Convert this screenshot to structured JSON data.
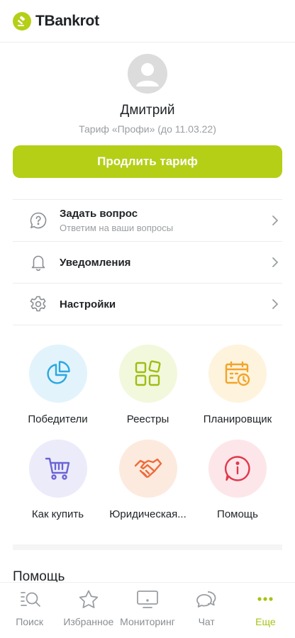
{
  "header": {
    "logo_text": "TBankrot"
  },
  "profile": {
    "name": "Дмитрий",
    "tariff": "Тариф «Профи» (до 11.03.22)"
  },
  "extend_button": {
    "label": "Продлить тариф"
  },
  "menu": {
    "items": [
      {
        "title": "Задать вопрос",
        "subtitle": "Ответим на ваши вопросы",
        "icon": "question-bubble-icon"
      },
      {
        "title": "Уведомления",
        "icon": "bell-icon"
      },
      {
        "title": "Настройки",
        "icon": "gear-icon"
      }
    ]
  },
  "tiles": [
    {
      "label": "Победители",
      "icon": "pie-chart-icon",
      "bg": "#e2f3fb",
      "color": "#2aa8e0"
    },
    {
      "label": "Реестры",
      "icon": "grid-icon",
      "bg": "#f2f8dc",
      "color": "#9fbc12"
    },
    {
      "label": "Планировщик",
      "icon": "calendar-clock-icon",
      "bg": "#fef3dc",
      "color": "#f2a42a"
    },
    {
      "label": "Как купить",
      "icon": "cart-icon",
      "bg": "#ecebfa",
      "color": "#6a64d6"
    },
    {
      "label": "Юридическая...",
      "icon": "handshake-icon",
      "bg": "#fdeade",
      "color": "#ef6a3a"
    },
    {
      "label": "Помощь",
      "icon": "info-icon",
      "bg": "#fde6e9",
      "color": "#e1384b"
    }
  ],
  "section": {
    "title": "Помощь"
  },
  "tabbar": {
    "tabs": [
      {
        "label": "Поиск",
        "icon": "search-list-icon"
      },
      {
        "label": "Избранное",
        "icon": "star-icon"
      },
      {
        "label": "Мониторинг",
        "icon": "monitor-icon"
      },
      {
        "label": "Чат",
        "icon": "chat-icon"
      },
      {
        "label": "Еще",
        "icon": "more-dots-icon",
        "active": true
      }
    ]
  },
  "colors": {
    "accent": "#b5cf17",
    "accent_text": "#a5c413",
    "muted": "#9a9ea2"
  }
}
